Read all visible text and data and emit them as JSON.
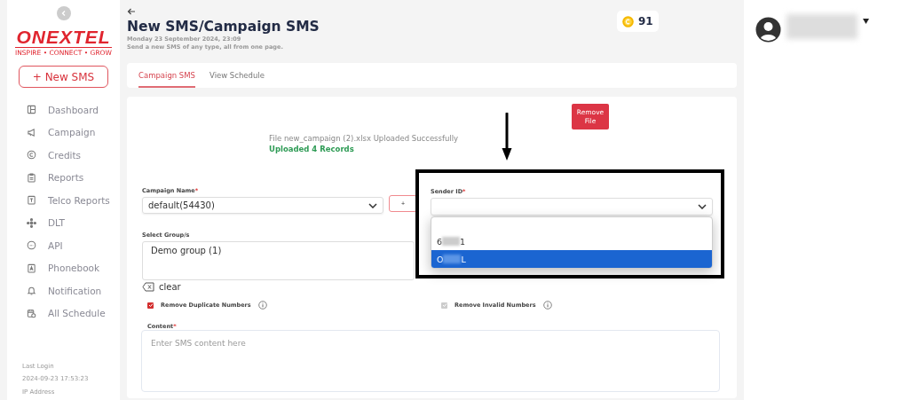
{
  "sidebar": {
    "logo": "ONEXTEL",
    "tagline": "INSPIRE • CONNECT • GROW",
    "new_button": "+ New SMS",
    "items": [
      {
        "label": "Dashboard"
      },
      {
        "label": "Campaign"
      },
      {
        "label": "Credits"
      },
      {
        "label": "Reports"
      },
      {
        "label": "Telco Reports"
      },
      {
        "label": "DLT"
      },
      {
        "label": "API"
      },
      {
        "label": "Phonebook"
      },
      {
        "label": "Notification"
      },
      {
        "label": "All Schedule"
      }
    ],
    "last_login_label": "Last Login",
    "last_login": "2024-09-23 17:53:23",
    "ip_label": "IP Address"
  },
  "header": {
    "title": "New SMS/Campaign SMS",
    "date": "Monday 23 September 2024, 23:09",
    "subtitle": "Send a new SMS of any type, all from one page.",
    "credits": "91"
  },
  "tabs": [
    {
      "label": "Campaign SMS",
      "selected": true
    },
    {
      "label": "View Schedule",
      "selected": false
    }
  ],
  "form": {
    "remove_file": "Remove File",
    "upload_message": "File new_campaign (2).xlsx Uploaded Successfully",
    "upload_count": "Uploaded 4 Records",
    "campaign_name": {
      "label": "Campaign Name",
      "mark": "*",
      "value": "default(54430)",
      "add_button": "+"
    },
    "sender_id": {
      "label": "Sender ID",
      "mark": "*",
      "options": [
        {
          "start": "6",
          "end": "1",
          "selected": false
        },
        {
          "start": "O",
          "end": "L",
          "selected": true
        }
      ]
    },
    "groups": {
      "label": "Select Group/s",
      "value": "Demo group (1)",
      "clear": "clear"
    },
    "checkboxes": [
      {
        "label": "Remove Duplicate Numbers",
        "checked": true,
        "disabled": false
      },
      {
        "label": "Remove Invalid Numbers",
        "checked": true,
        "disabled": true
      }
    ],
    "content": {
      "label": "Content",
      "mark": "*",
      "placeholder": "Enter SMS content here"
    }
  }
}
